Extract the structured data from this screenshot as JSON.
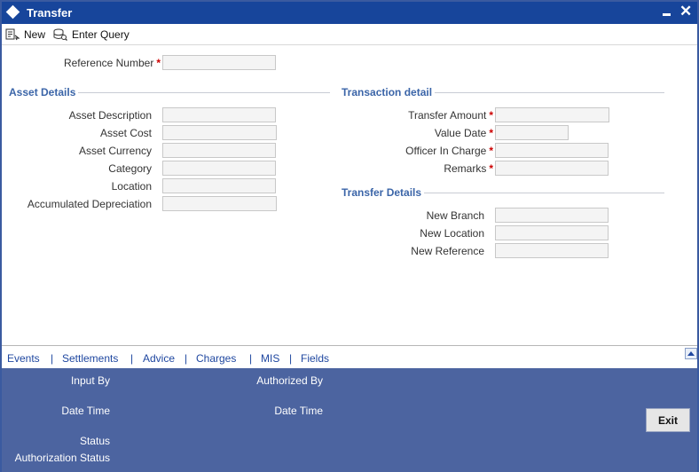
{
  "window": {
    "title": "Transfer"
  },
  "toolbar": {
    "new_label": "New",
    "enter_query_label": "Enter Query"
  },
  "header": {
    "reference_number_label": "Reference Number",
    "reference_number_value": ""
  },
  "asset_details": {
    "title": "Asset Details",
    "fields": [
      {
        "label": "Asset Description",
        "value": ""
      },
      {
        "label": "Asset Cost",
        "value": ""
      },
      {
        "label": "Asset Currency",
        "value": ""
      },
      {
        "label": "Category",
        "value": ""
      },
      {
        "label": "Location",
        "value": ""
      },
      {
        "label": "Accumulated Depreciation",
        "value": ""
      }
    ]
  },
  "transaction_detail": {
    "title": "Transaction detail",
    "fields": [
      {
        "label": "Transfer Amount",
        "value": ""
      },
      {
        "label": "Value Date",
        "value": ""
      },
      {
        "label": "Officer In Charge",
        "value": ""
      },
      {
        "label": "Remarks",
        "value": ""
      }
    ]
  },
  "transfer_details": {
    "title": "Transfer Details",
    "fields": [
      {
        "label": "New Branch",
        "value": ""
      },
      {
        "label": "New Location",
        "value": ""
      },
      {
        "label": "New Reference",
        "value": ""
      }
    ]
  },
  "footer_tabs": [
    "Events",
    "Settlements",
    "Advice",
    "Charges",
    "MIS",
    "Fields"
  ],
  "footer_separator": "|",
  "required_marker": "*",
  "audit": {
    "input_by": "Input By",
    "authorized_by": "Authorized By",
    "date_time": "Date Time",
    "date_time_2": "Date Time",
    "status": "Status",
    "authorization_status": "Authorization Status",
    "exit_label": "Exit"
  },
  "colors": {
    "titlebar": "#17459b",
    "audit_panel": "#4c64a0",
    "section_title": "#3b65a8",
    "required": "#cc0000"
  }
}
